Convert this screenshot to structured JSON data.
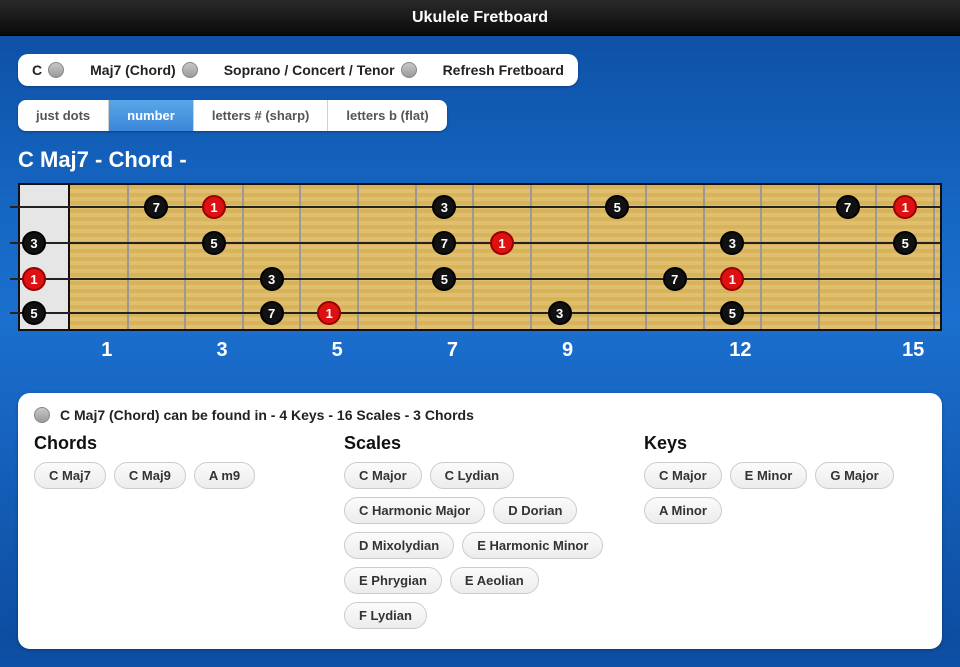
{
  "title": "Ukulele Fretboard",
  "selectors": {
    "key": "C",
    "chord": "Maj7 (Chord)",
    "tuning": "Soprano / Concert / Tenor",
    "refresh": "Refresh Fretboard"
  },
  "view_modes": [
    "just dots",
    "number",
    "letters # (sharp)",
    "letters b (flat)"
  ],
  "active_view_mode": 1,
  "chord_title": "C Maj7 - Chord -",
  "fretboard": {
    "num_frets": 15,
    "fret_markers": [
      1,
      3,
      5,
      7,
      9,
      12,
      15
    ],
    "strings": 4,
    "notes": [
      {
        "string": 3,
        "fret": 0,
        "label": "5",
        "root": false
      },
      {
        "string": 2,
        "fret": 0,
        "label": "1",
        "root": true
      },
      {
        "string": 1,
        "fret": 0,
        "label": "3",
        "root": false
      },
      {
        "string": 0,
        "fret": 2,
        "label": "7",
        "root": false
      },
      {
        "string": 0,
        "fret": 3,
        "label": "1",
        "root": true
      },
      {
        "string": 1,
        "fret": 3,
        "label": "5",
        "root": false
      },
      {
        "string": 2,
        "fret": 4,
        "label": "3",
        "root": false
      },
      {
        "string": 3,
        "fret": 4,
        "label": "7",
        "root": false
      },
      {
        "string": 3,
        "fret": 5,
        "label": "1",
        "root": true
      },
      {
        "string": 0,
        "fret": 7,
        "label": "3",
        "root": false
      },
      {
        "string": 1,
        "fret": 7,
        "label": "7",
        "root": false
      },
      {
        "string": 2,
        "fret": 7,
        "label": "5",
        "root": false
      },
      {
        "string": 1,
        "fret": 8,
        "label": "1",
        "root": true
      },
      {
        "string": 3,
        "fret": 9,
        "label": "3",
        "root": false
      },
      {
        "string": 0,
        "fret": 10,
        "label": "5",
        "root": false
      },
      {
        "string": 2,
        "fret": 11,
        "label": "7",
        "root": false
      },
      {
        "string": 3,
        "fret": 12,
        "label": "5",
        "root": false
      },
      {
        "string": 2,
        "fret": 12,
        "label": "1",
        "root": true
      },
      {
        "string": 1,
        "fret": 12,
        "label": "3",
        "root": false
      },
      {
        "string": 0,
        "fret": 14,
        "label": "7",
        "root": false
      },
      {
        "string": 0,
        "fret": 15,
        "label": "1",
        "root": true
      },
      {
        "string": 1,
        "fret": 15,
        "label": "5",
        "root": false
      }
    ]
  },
  "related": {
    "summary": "C Maj7 (Chord) can be found in - 4 Keys - 16 Scales - 3 Chords",
    "chords_heading": "Chords",
    "scales_heading": "Scales",
    "keys_heading": "Keys",
    "chords": [
      "C Maj7",
      "C Maj9",
      "A m9"
    ],
    "scales": [
      "C Major",
      "C Lydian",
      "C Harmonic Major",
      "D Dorian",
      "D Mixolydian",
      "E Harmonic Minor",
      "E Phrygian",
      "E Aeolian",
      "F Lydian"
    ],
    "keys": [
      "C Major",
      "E Minor",
      "G Major",
      "A Minor"
    ]
  }
}
